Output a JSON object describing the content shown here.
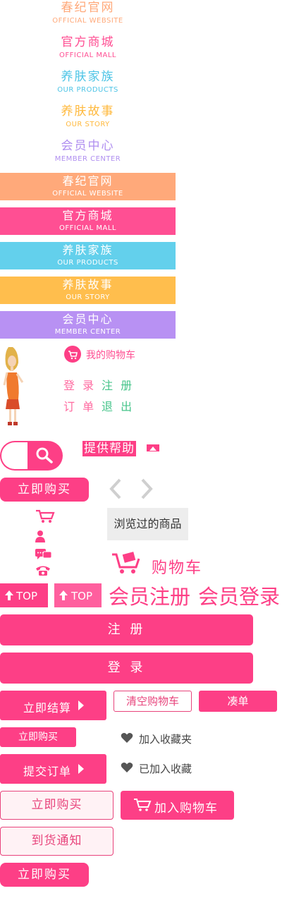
{
  "nav_text": [
    {
      "cn": "春纪官网",
      "en": "OFFICIAL WEBSITE",
      "color": "#ffa97a"
    },
    {
      "cn": "官方商城",
      "en": "OFFICIAL MALL",
      "color": "#ff4f93"
    },
    {
      "cn": "养肤家族",
      "en": "OUR PRODUCTS",
      "color": "#4dc4e6"
    },
    {
      "cn": "养肤故事",
      "en": "OUR  STORY",
      "color": "#ffb93d"
    },
    {
      "cn": "会员中心",
      "en": "MEMBER CENTER",
      "color": "#b08ff0"
    }
  ],
  "nav_block": [
    {
      "cn": "春纪官网",
      "en": "OFFICIAL WEBSITE",
      "color": "#ffa97a"
    },
    {
      "cn": "官方商城",
      "en": "OFFICIAL MALL",
      "color": "#ff4f93"
    },
    {
      "cn": "养肤家族",
      "en": "OUR PRODUCTS",
      "color": "#63d0ec"
    },
    {
      "cn": "养肤故事",
      "en": "OUR  STORY",
      "color": "#ffbe4d"
    },
    {
      "cn": "会员中心",
      "en": "MEMBER CENTER",
      "color": "#b891f3"
    }
  ],
  "user_panel": {
    "cart_link": "我的购物车",
    "login": "登 录",
    "register": "注 册",
    "orders": "订 单",
    "logout": "退 出"
  },
  "help_label": "提供帮助",
  "buy_now": "立即购买",
  "browsed_label": "浏览过的商品",
  "cart_big_label": "购物车",
  "top_label": "TOP",
  "member_register": "会员注册",
  "member_login": "会员登录",
  "register_button": "注 册",
  "login_button": "登 录",
  "checkout": "立即结算",
  "clear_cart": "清空购物车",
  "make_up_order": "凑单",
  "buy_now_small": "立即购买",
  "add_favorite": "加入收藏夹",
  "submit_order": "提交订单",
  "added_favorite": "已加入收藏",
  "buy_now_outline": "立即购买",
  "add_to_cart": "加入购物车",
  "arrival_notice": "到货通知",
  "buy_now_bottom": "立即购买",
  "colors": {
    "accent": "#fd3f86",
    "accent_light": "#ff4f93",
    "cart_green": "#45c48a"
  }
}
